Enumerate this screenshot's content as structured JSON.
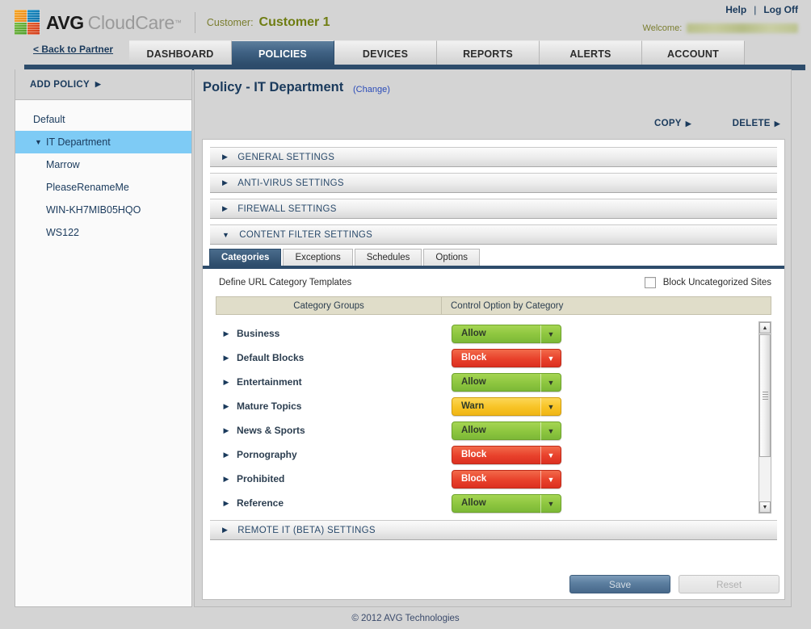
{
  "brand": {
    "logo_primary": "AVG",
    "logo_secondary": "CloudCare",
    "logo_tm": "™",
    "logo_icon": "avg-pinwheel-icon"
  },
  "header": {
    "customer_label": "Customer:",
    "customer_name": "Customer 1",
    "help_label": "Help",
    "separator": "|",
    "logoff_label": "Log Off",
    "welcome_label": "Welcome:",
    "welcome_value": "redacted.address@avg.com",
    "back_to_partner": "< Back to Partner"
  },
  "nav": {
    "tabs": [
      {
        "label": "DASHBOARD",
        "active": false
      },
      {
        "label": "POLICIES",
        "active": true
      },
      {
        "label": "DEVICES",
        "active": false
      },
      {
        "label": "REPORTS",
        "active": false
      },
      {
        "label": "ALERTS",
        "active": false
      },
      {
        "label": "ACCOUNT",
        "active": false
      }
    ]
  },
  "sidebar": {
    "add_policy_label": "ADD POLICY",
    "add_policy_arrow": "▶",
    "items": [
      {
        "label": "Default",
        "level": 0,
        "selected": false,
        "caret": ""
      },
      {
        "label": "IT Department",
        "level": 0,
        "selected": true,
        "caret": "▼"
      },
      {
        "label": "Marrow",
        "level": 1,
        "selected": false,
        "caret": ""
      },
      {
        "label": "PleaseRenameMe",
        "level": 1,
        "selected": false,
        "caret": ""
      },
      {
        "label": "WIN-KH7MIB05HQO",
        "level": 1,
        "selected": false,
        "caret": ""
      },
      {
        "label": "WS122",
        "level": 1,
        "selected": false,
        "caret": ""
      }
    ]
  },
  "main": {
    "title": "Policy - IT Department",
    "change_link": "(Change)",
    "copy_label": "COPY",
    "delete_label": "DELETE",
    "arrow_right": "▶",
    "arrow_down": "▼",
    "sections": [
      {
        "label": "GENERAL SETTINGS",
        "expanded": false
      },
      {
        "label": "ANTI-VIRUS SETTINGS",
        "expanded": false
      },
      {
        "label": "FIREWALL SETTINGS",
        "expanded": false
      },
      {
        "label": "CONTENT FILTER SETTINGS",
        "expanded": true
      }
    ],
    "remote_section": {
      "label": "REMOTE IT (BETA) SETTINGS",
      "expanded": false
    }
  },
  "content_filter": {
    "tabs": [
      {
        "label": "Categories",
        "active": true
      },
      {
        "label": "Exceptions",
        "active": false
      },
      {
        "label": "Schedules",
        "active": false
      },
      {
        "label": "Options",
        "active": false
      }
    ],
    "define_label": "Define URL Category Templates",
    "block_uncategorized_label": "Block Uncategorized Sites",
    "block_uncategorized_checked": false,
    "columns": [
      "Category Groups",
      "Control Option by Category"
    ],
    "rows": [
      {
        "name": "Business",
        "control": "Allow",
        "state": "allow"
      },
      {
        "name": "Default Blocks",
        "control": "Block",
        "state": "block"
      },
      {
        "name": "Entertainment",
        "control": "Allow",
        "state": "allow"
      },
      {
        "name": "Mature Topics",
        "control": "Warn",
        "state": "warn"
      },
      {
        "name": "News & Sports",
        "control": "Allow",
        "state": "allow"
      },
      {
        "name": "Pornography",
        "control": "Block",
        "state": "block"
      },
      {
        "name": "Prohibited",
        "control": "Block",
        "state": "block"
      },
      {
        "name": "Reference",
        "control": "Allow",
        "state": "allow"
      }
    ],
    "row_expand_arrow": "▶",
    "dropdown_arrow": "▼",
    "scrollbar": {
      "up_arrow": "▲",
      "down_arrow": "▼"
    }
  },
  "actions": {
    "save_label": "Save",
    "save_enabled": false,
    "reset_label": "Reset",
    "reset_enabled": false
  },
  "footer": {
    "copyright": "© 2012 AVG Technologies"
  },
  "colors": {
    "accent_dark_blue": "#2d4c6b",
    "link_blue": "#1a3a5c",
    "selected_row": "#7ecbf5",
    "allow_green": "#8dc63f",
    "block_red": "#e8412b",
    "warn_yellow": "#f7c325",
    "grid_header_tan": "#e0ddc9",
    "customer_olive": "#6f7d12"
  }
}
